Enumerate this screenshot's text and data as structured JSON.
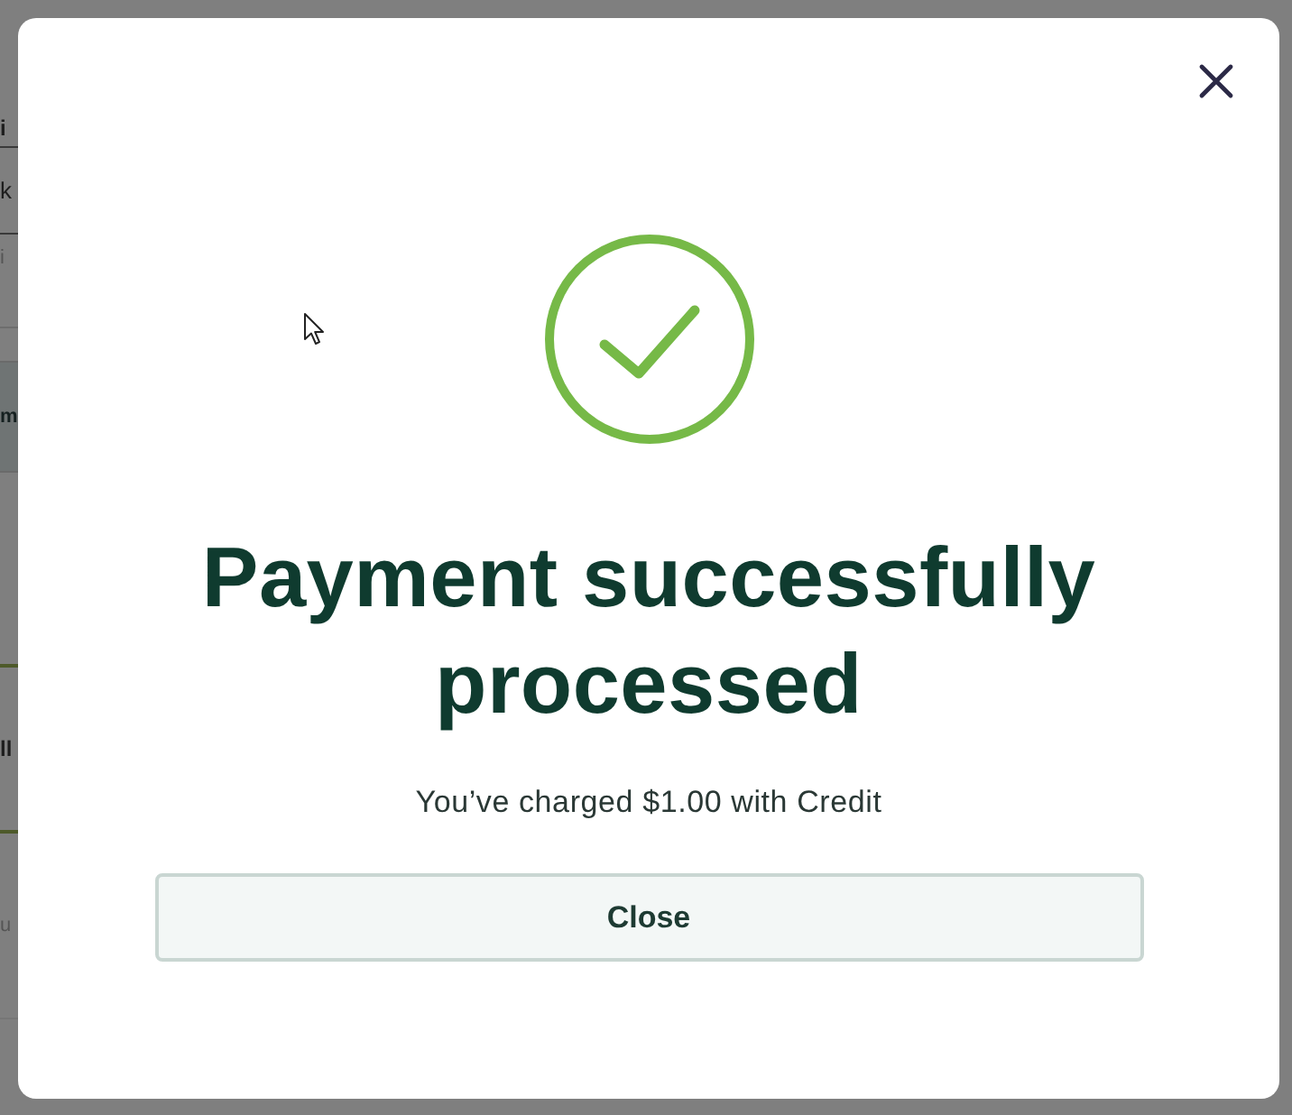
{
  "background": {
    "fragments": [
      {
        "text": "i",
        "kind": "heading"
      },
      {
        "text": "k",
        "kind": "value"
      },
      {
        "text": "i",
        "kind": "hint"
      },
      {
        "text": "m",
        "kind": "band"
      },
      {
        "text": "ll",
        "kind": "heading"
      },
      {
        "text": "u",
        "kind": "hint"
      }
    ]
  },
  "dialog": {
    "title": "Payment successfully processed",
    "message": "You’ve charged $1.00 with Credit",
    "buttons": [
      {
        "label": "Close"
      }
    ]
  }
}
